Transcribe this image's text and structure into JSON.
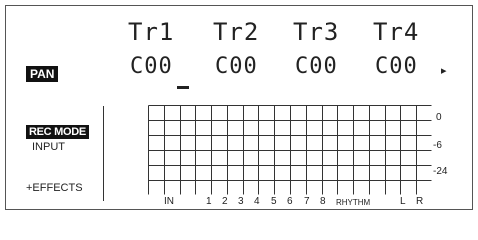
{
  "screen": {
    "mode_label": "PAN",
    "tracks": [
      {
        "name": "Tr1",
        "pan": "C00"
      },
      {
        "name": "Tr2",
        "pan": "C00"
      },
      {
        "name": "Tr3",
        "pan": "C00"
      },
      {
        "name": "Tr4",
        "pan": "C00"
      }
    ],
    "scroll_indicator": "▸",
    "rec_mode_label": "REC MODE",
    "input_label": "INPUT",
    "effects_label": "+EFFECTS"
  },
  "meter": {
    "db_labels": [
      "0",
      "-6",
      "-24"
    ],
    "channels": [
      "IN",
      "1",
      "2",
      "3",
      "4",
      "5",
      "6",
      "7",
      "8",
      "RHYTHM",
      "L",
      "R"
    ]
  }
}
